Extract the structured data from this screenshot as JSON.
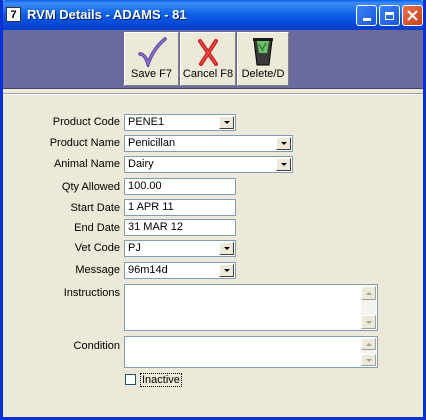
{
  "window": {
    "title": "RVM Details - ADAMS - 81",
    "icon_glyph": "7",
    "icon": "app-7-icon"
  },
  "titlebar_buttons": [
    {
      "name": "minimize",
      "icon": "minimize-icon"
    },
    {
      "name": "maximize",
      "icon": "maximize-icon"
    },
    {
      "name": "close",
      "icon": "close-icon",
      "glyph": "✕"
    }
  ],
  "toolbar": {
    "background": "#6a6a9c",
    "save_label": "Save F7",
    "save_icon": "checkmark-icon",
    "cancel_label": "Cancel F8",
    "cancel_icon": "red-x-icon",
    "delete_label": "Delete/D",
    "delete_icon": "trash-bin-icon"
  },
  "form": {
    "product_code": {
      "label": "Product Code",
      "value": "PENE1"
    },
    "product_name": {
      "label": "Product Name",
      "value": "Penicillan"
    },
    "animal_name": {
      "label": "Animal Name",
      "value": "Dairy"
    },
    "qty_allowed": {
      "label": "Qty Allowed",
      "value": "100.00"
    },
    "start_date": {
      "label": "Start Date",
      "value": "1 APR 11"
    },
    "end_date": {
      "label": "End Date",
      "value": "31 MAR 12"
    },
    "vet_code": {
      "label": "Vet Code",
      "value": "PJ"
    },
    "message": {
      "label": "Message",
      "value": "96m14d"
    },
    "instructions": {
      "label": "Instructions",
      "value": ""
    },
    "condition": {
      "label": "Condition",
      "value": ""
    },
    "inactive": {
      "label": "Inactive",
      "checked": false
    }
  }
}
